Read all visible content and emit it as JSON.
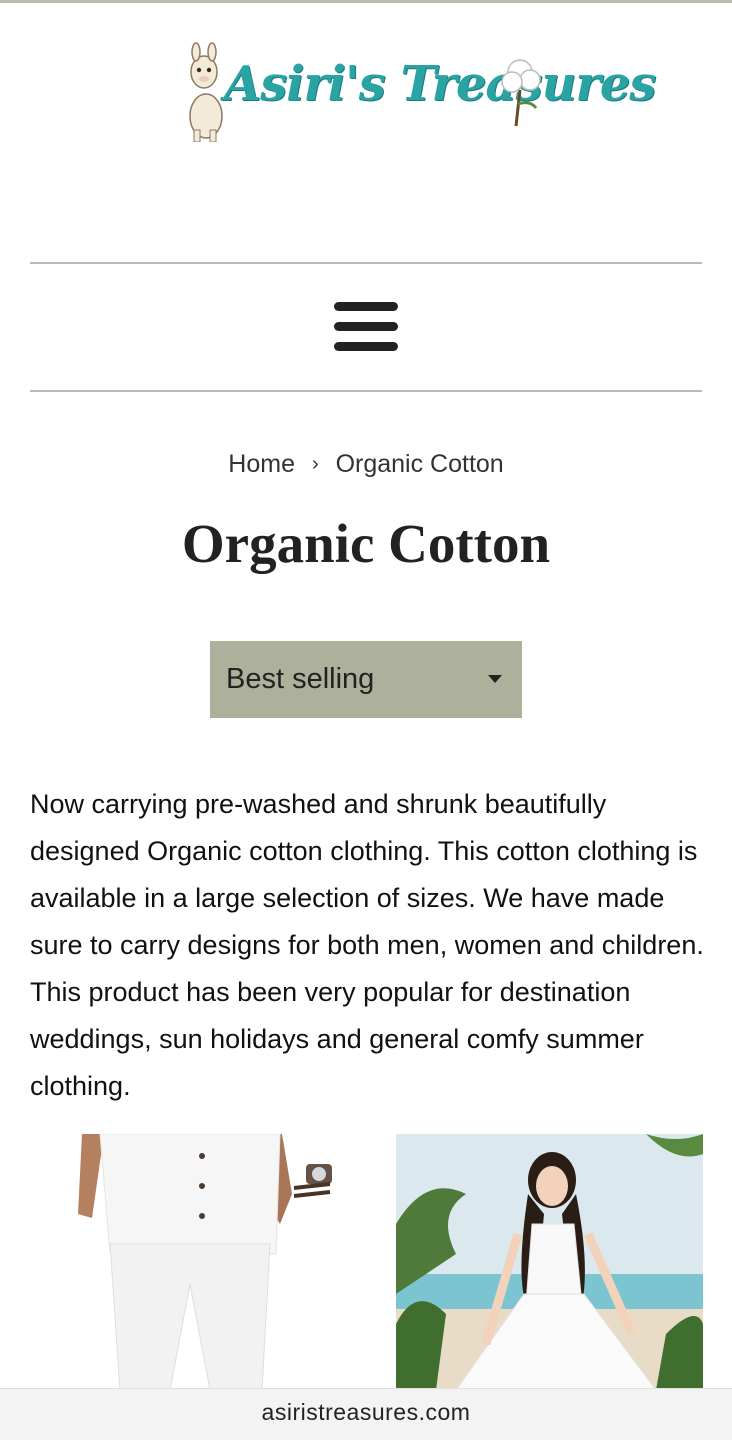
{
  "header": {
    "logo_text": "Asiri's Treasures"
  },
  "nav": {
    "menu_icon": "hamburger-menu-icon"
  },
  "breadcrumb": {
    "home": "Home",
    "separator": "›",
    "current": "Organic Cotton"
  },
  "page": {
    "title": "Organic Cotton"
  },
  "sort": {
    "selected": "Best selling"
  },
  "description": "Now carrying pre-washed and shrunk beautifully designed Organic cotton clothing. This cotton clothing is available in a large selection of sizes. We have made sure to carry designs for both men, women and children. This product has been very popular for destination weddings, sun holidays and general comfy summer clothing.",
  "browser": {
    "url": "asiristreasures.com"
  },
  "colors": {
    "accent_teal": "#2aa3a3",
    "rule": "#b9bcae",
    "sort_bg": "#adb09a"
  }
}
